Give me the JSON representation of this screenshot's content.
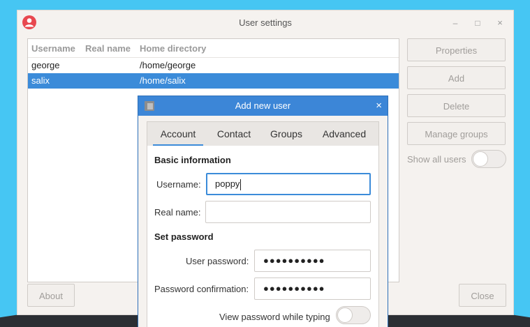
{
  "window": {
    "title": "User settings",
    "controls": {
      "minimize": "–",
      "maximize": "□",
      "close": "×"
    }
  },
  "user_list": {
    "columns": [
      "Username",
      "Real name",
      "Home directory"
    ],
    "rows": [
      {
        "username": "george",
        "real_name": "",
        "home": "/home/george",
        "selected": false
      },
      {
        "username": "salix",
        "real_name": "",
        "home": "/home/salix",
        "selected": true
      }
    ]
  },
  "side_buttons": {
    "properties": "Properties",
    "add": "Add",
    "delete": "Delete",
    "manage_groups": "Manage groups"
  },
  "show_all_users": {
    "label": "Show all users",
    "on": false
  },
  "bottom": {
    "about": "About",
    "close": "Close"
  },
  "dialog": {
    "title": "Add new user",
    "close": "×",
    "tabs": [
      "Account",
      "Contact",
      "Groups",
      "Advanced"
    ],
    "active_tab": "Account",
    "basic_info": {
      "heading": "Basic information",
      "username_label": "Username:",
      "username_value": "poppy",
      "realname_label": "Real name:",
      "realname_value": ""
    },
    "password": {
      "heading": "Set password",
      "user_password_label": "User password:",
      "user_password_value": "●●●●●●●●●●",
      "confirm_label": "Password confirmation:",
      "confirm_value": "●●●●●●●●●●",
      "view_label": "View password while typing",
      "view_on": false
    }
  }
}
